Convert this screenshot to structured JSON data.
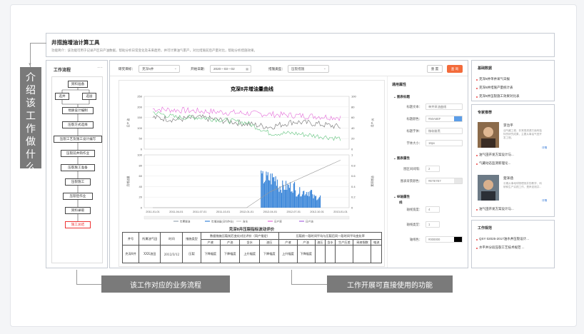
{
  "header": {
    "title": "井措施增油计算工具",
    "desc": "功能简介：该功能可用于记录产区日产油数据，帮助分析日常变化及未来趋势，并可计算油气累产，对比措施前后产量对比，帮助分析措施效果。"
  },
  "flow": {
    "title": "工作流程",
    "menu": "···",
    "nodes": [
      "资料准备",
      "选井",
      "选层",
      "地质设计编制",
      "压裂方式选择",
      "压裂工艺及施工设计编写",
      "压裂前井筒作业",
      "压裂施工准备",
      "压裂施工",
      "压裂后作业",
      "资料录取",
      "施工总结"
    ]
  },
  "toolbar": {
    "target_label": "研究目标：",
    "target_value": "克深8井",
    "date_label": "开始日期：",
    "date_value": "2020－03－02",
    "type_label": "措施类型：",
    "type_value": "压裂措施",
    "btn_reset": "重 置",
    "btn_query": "查 询"
  },
  "chart": {
    "title": "克深8井增油量曲线",
    "x_ticks": [
      "2011-01-01",
      "2011-04-01",
      "2011-07-01",
      "2011-10-01",
      "2012-01-01",
      "2012-04-01",
      "2012-07-01",
      "2012-10-01",
      "2013-01-01"
    ],
    "top_left_ticks": [
      "250",
      "200",
      "150",
      "100",
      "50",
      "0"
    ],
    "top_right_ticks": [
      "100",
      "80",
      "60",
      "40",
      "20",
      "0"
    ],
    "bottom_left_ticks": [
      "100",
      "80",
      "60",
      "40",
      "20",
      "0"
    ],
    "bottom_right_ticks": [
      "1",
      "0.8",
      "0.6",
      "0.4",
      "0.2",
      "0"
    ],
    "top_left_axis": "日产 油",
    "top_right_axis": "月产 (t)",
    "bottom_left_axis": "月增油量",
    "bottom_right_axis": "累积增油",
    "legend": [
      "年累增油",
      "年增油量(日均作业)",
      "含水",
      "日产液",
      "日产油"
    ]
  },
  "chart_data": {
    "type": "line",
    "title": "克深8井增油量曲线",
    "x": [
      "2011-01-01",
      "2011-04-01",
      "2011-07-01",
      "2011-10-01",
      "2012-01-01",
      "2012-04-01",
      "2012-07-01",
      "2012-10-01",
      "2013-01-01"
    ],
    "series": [
      {
        "name": "日产液",
        "values": [
          190,
          185,
          180,
          175,
          170,
          165,
          160,
          155,
          150
        ]
      },
      {
        "name": "日产油",
        "values": [
          150,
          140,
          150,
          135,
          120,
          105,
          130,
          120,
          105
        ]
      },
      {
        "name": "含水",
        "values": [
          70,
          60,
          60,
          55,
          50,
          30,
          30,
          25,
          20
        ]
      },
      {
        "name": "年累增油",
        "values": [
          0,
          0,
          0,
          0,
          0,
          0.3,
          0.5,
          0.7,
          0.9
        ]
      },
      {
        "name": "年增油量(日均作业)",
        "values": [
          0,
          0,
          0,
          0,
          0,
          55,
          40,
          30,
          20
        ]
      }
    ],
    "ylim": [
      0,
      250
    ]
  },
  "table": {
    "title": "克深8井压裂指标波动评价",
    "headers": [
      "井号",
      "所属油气田",
      "时间",
      "措施类型",
      "数据措施压裂前后变化对比评价（同产指定）",
      "压裂前一段时间平均与压裂后同一段时间平均变化率"
    ],
    "sub": [
      "产液",
      "产油",
      "含水",
      "油压",
      "产液",
      "产油",
      "油压",
      "含水",
      "生产压差",
      "采液指数",
      "电流"
    ],
    "row": [
      "克深8井",
      "XXX油田",
      "2012/3/12",
      "压裂",
      "下降幅度",
      "下降幅度",
      "上升幅度",
      "下降幅度",
      "上升幅度",
      "下降幅度"
    ]
  },
  "props": {
    "title": "通用属性",
    "sec1": "图表标题",
    "title_text_label": "标题文本：",
    "title_text_value": "单井采油曲线",
    "title_color_label": "标题颜色：",
    "title_color_value": "#50A6EF",
    "title_font_label": "标题字体：",
    "title_font_value": "微软雅黑",
    "font_size_label": "字体大小：",
    "font_size_value": "16px",
    "sec2": "图表属性",
    "gap_label": "图区间间隔：",
    "gap_value": "2",
    "bg_label": "图表背景颜色：",
    "bg_value": "#E7E7E7",
    "sec3": "纵轴属性",
    "sec3b": "线",
    "axis_width_label": "轴线宽度：",
    "axis_width_value": "4",
    "axis_type_label": "轴线类型：",
    "axis_type_value": "1",
    "axis_color_label": "轴线色：",
    "axis_color_value": "#000000",
    "colors": {
      "title": "#5b9de8",
      "bg": "#e7e7e7",
      "axis": "#000000"
    }
  },
  "side": {
    "basic_title": "基础数据",
    "basic_links": [
      "克深8井单井采气日报",
      "克深8井措施产量统计表",
      "克深8井压裂施工效果对比表"
    ],
    "expert_title": "专家推荐",
    "expert1_name": "李治平",
    "expert1_desc": "油气藏工程、非常规资源方面有独特的研究成果，主要从事油气田开发工程。",
    "expert_links1": [
      "油气田开发方案设计与...",
      "气藏动态监测新理论..."
    ],
    "expert2_name": "楚泽涵",
    "expert2_desc": "长期从事地球物理测井的教学、科研和生产实践工作，是声波测井...",
    "expert_links2": [
      "油气田开发方案设计与..."
    ],
    "more": "详情",
    "norm_title": "工作规范",
    "norm_links": [
      "QSY 02025-2017油水井压裂设计...",
      "水平井分段压裂工艺技术规范 ..."
    ]
  },
  "annotations": {
    "left": "介绍该工作做什么",
    "bottom_left": "该工作对应的业务流程",
    "bottom_right": "工作开展可直接使用的功能"
  }
}
